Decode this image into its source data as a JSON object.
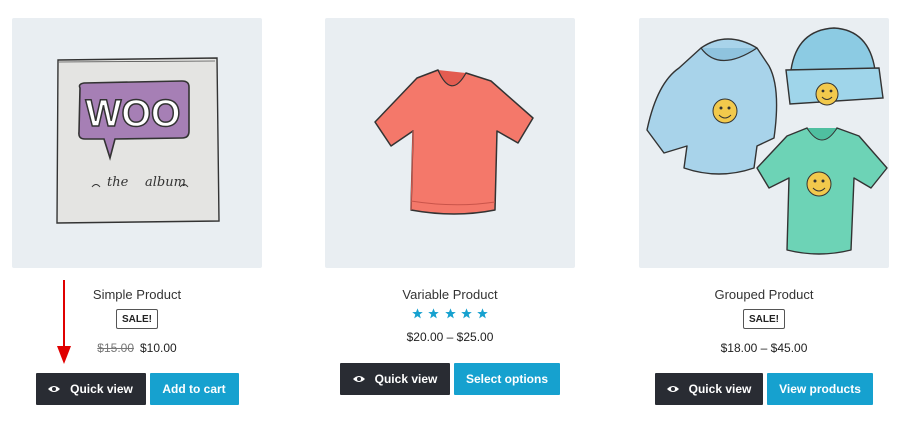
{
  "accent_color": "#16a1cf",
  "dark_button_color": "#292c33",
  "annotation_color": "#e00000",
  "products": [
    {
      "title": "Simple Product",
      "badge": "SALE!",
      "price_old": "$15.00",
      "price": "$10.00",
      "image_text": [
        "WOO",
        "the",
        "album"
      ],
      "quick_view_label": "Quick view",
      "action_label": "Add to cart"
    },
    {
      "title": "Variable Product",
      "rating": 5,
      "rating_max": 5,
      "price": "$20.00 – $25.00",
      "quick_view_label": "Quick view",
      "action_label": "Select options"
    },
    {
      "title": "Grouped Product",
      "badge": "SALE!",
      "price": "$18.00 – $45.00",
      "quick_view_label": "Quick view",
      "action_label": "View products"
    }
  ]
}
